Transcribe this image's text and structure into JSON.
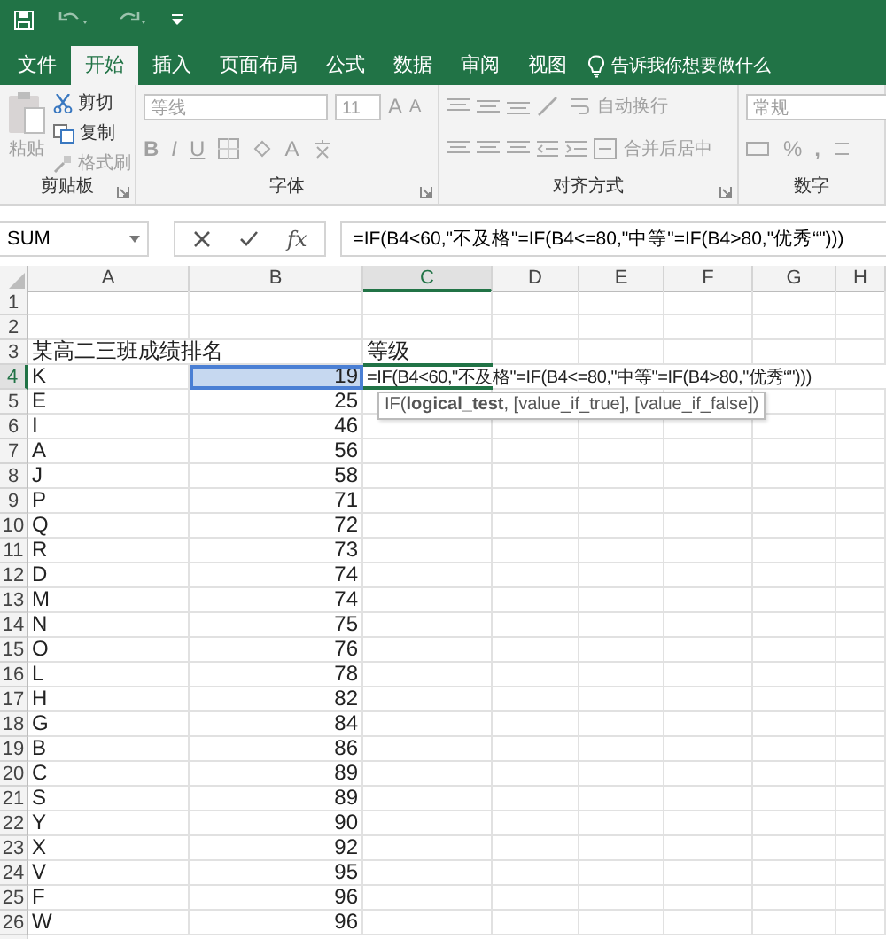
{
  "tabs": [
    {
      "label": "文件",
      "selected": false
    },
    {
      "label": "开始",
      "selected": true
    },
    {
      "label": "插入",
      "selected": false
    },
    {
      "label": "页面布局",
      "selected": false
    },
    {
      "label": "公式",
      "selected": false
    },
    {
      "label": "数据",
      "selected": false
    },
    {
      "label": "审阅",
      "selected": false
    },
    {
      "label": "视图",
      "selected": false
    }
  ],
  "tell_me": "告诉我你想要做什么",
  "ribbon": {
    "groups": [
      {
        "kind": "clipboard",
        "label": "剪贴板",
        "paste": "粘贴",
        "disabled": true,
        "items": [
          {
            "label": "剪切",
            "disabled": false
          },
          {
            "label": "复制",
            "disabled": false
          },
          {
            "label": "格式刷",
            "disabled": true
          }
        ]
      },
      {
        "kind": "font",
        "label": "字体",
        "disabled": true,
        "font_name": "等线",
        "font_size": "11",
        "bold": "B",
        "italic": "I",
        "underline": "U",
        "grow_font": "A",
        "shrink_font": "A",
        "font_color": "A"
      },
      {
        "kind": "alignment",
        "label": "对齐方式",
        "disabled": true,
        "wrap": "自动换行",
        "merge": "合并后居中"
      },
      {
        "kind": "number",
        "label": "数字",
        "disabled": true,
        "format": "常规",
        "percent": "%",
        "comma": ","
      }
    ]
  },
  "formula_bar": {
    "name_box": "SUM",
    "fx": "fx",
    "formula": "=IF(B4<60,\"不及格\"=IF(B4<=80,\"中等\"=IF(B4>80,\"优秀“\")))"
  },
  "sheet": {
    "columns": [
      {
        "label": "A",
        "selected": false
      },
      {
        "label": "B",
        "selected": false
      },
      {
        "label": "C",
        "selected": true
      },
      {
        "label": "D",
        "selected": false
      },
      {
        "label": "E",
        "selected": false
      },
      {
        "label": "F",
        "selected": false
      },
      {
        "label": "G",
        "selected": false
      },
      {
        "label": "H",
        "selected": false
      }
    ],
    "rows": [
      {
        "header": "1",
        "selected": false
      },
      {
        "header": "2",
        "selected": false
      },
      {
        "header": "3",
        "selected": false,
        "a": {
          "text": "某高二三班成绩排名",
          "selected": false
        },
        "c": {
          "text": "等级"
        }
      },
      {
        "header": "4",
        "selected": true,
        "a": {
          "text": "K",
          "selected": false
        },
        "b": {
          "text": "19",
          "selected": true
        },
        "c": {
          "text": "=IF(B4<60,\"不及格\"=IF(B4<=80,\"中等\"=IF(B4>80,\"优秀“\")))",
          "editing": true
        }
      },
      {
        "header": "5",
        "selected": false,
        "a": {
          "text": "E",
          "selected": false
        },
        "b": {
          "text": "25",
          "selected": false
        }
      },
      {
        "header": "6",
        "selected": false,
        "a": {
          "text": "I",
          "selected": false
        },
        "b": {
          "text": "46",
          "selected": false
        }
      },
      {
        "header": "7",
        "selected": false,
        "a": {
          "text": "A",
          "selected": false
        },
        "b": {
          "text": "56",
          "selected": false
        }
      },
      {
        "header": "8",
        "selected": false,
        "a": {
          "text": "J",
          "selected": false
        },
        "b": {
          "text": "58",
          "selected": false
        }
      },
      {
        "header": "9",
        "selected": false,
        "a": {
          "text": "P",
          "selected": false
        },
        "b": {
          "text": "71",
          "selected": false
        }
      },
      {
        "header": "10",
        "selected": false,
        "a": {
          "text": "Q",
          "selected": false
        },
        "b": {
          "text": "72",
          "selected": false
        }
      },
      {
        "header": "11",
        "selected": false,
        "a": {
          "text": "R",
          "selected": false
        },
        "b": {
          "text": "73",
          "selected": false
        }
      },
      {
        "header": "12",
        "selected": false,
        "a": {
          "text": "D",
          "selected": false
        },
        "b": {
          "text": "74",
          "selected": false
        }
      },
      {
        "header": "13",
        "selected": false,
        "a": {
          "text": "M",
          "selected": false
        },
        "b": {
          "text": "74",
          "selected": false
        }
      },
      {
        "header": "14",
        "selected": false,
        "a": {
          "text": "N",
          "selected": false
        },
        "b": {
          "text": "75",
          "selected": false
        }
      },
      {
        "header": "15",
        "selected": false,
        "a": {
          "text": "O",
          "selected": false
        },
        "b": {
          "text": "76",
          "selected": false
        }
      },
      {
        "header": "16",
        "selected": false,
        "a": {
          "text": "L",
          "selected": false
        },
        "b": {
          "text": "78",
          "selected": false
        }
      },
      {
        "header": "17",
        "selected": false,
        "a": {
          "text": "H",
          "selected": false
        },
        "b": {
          "text": "82",
          "selected": false
        }
      },
      {
        "header": "18",
        "selected": false,
        "a": {
          "text": "G",
          "selected": false
        },
        "b": {
          "text": "84",
          "selected": false
        }
      },
      {
        "header": "19",
        "selected": false,
        "a": {
          "text": "B",
          "selected": false
        },
        "b": {
          "text": "86",
          "selected": false
        }
      },
      {
        "header": "20",
        "selected": false,
        "a": {
          "text": "C",
          "selected": false
        },
        "b": {
          "text": "89",
          "selected": false
        }
      },
      {
        "header": "21",
        "selected": false,
        "a": {
          "text": "S",
          "selected": false
        },
        "b": {
          "text": "89",
          "selected": false
        }
      },
      {
        "header": "22",
        "selected": false,
        "a": {
          "text": "Y",
          "selected": false
        },
        "b": {
          "text": "90",
          "selected": false
        }
      },
      {
        "header": "23",
        "selected": false,
        "a": {
          "text": "X",
          "selected": false
        },
        "b": {
          "text": "92",
          "selected": false
        }
      },
      {
        "header": "24",
        "selected": false,
        "a": {
          "text": "V",
          "selected": false
        },
        "b": {
          "text": "95",
          "selected": false
        }
      },
      {
        "header": "25",
        "selected": false,
        "a": {
          "text": "F",
          "selected": false
        },
        "b": {
          "text": "96",
          "selected": false
        }
      },
      {
        "header": "26",
        "selected": false,
        "a": {
          "text": "W",
          "selected": false
        },
        "b": {
          "text": "96",
          "selected": false
        }
      }
    ],
    "tooltip": "IF(**logical_test**, [value_if_true], [value_if_false])"
  }
}
